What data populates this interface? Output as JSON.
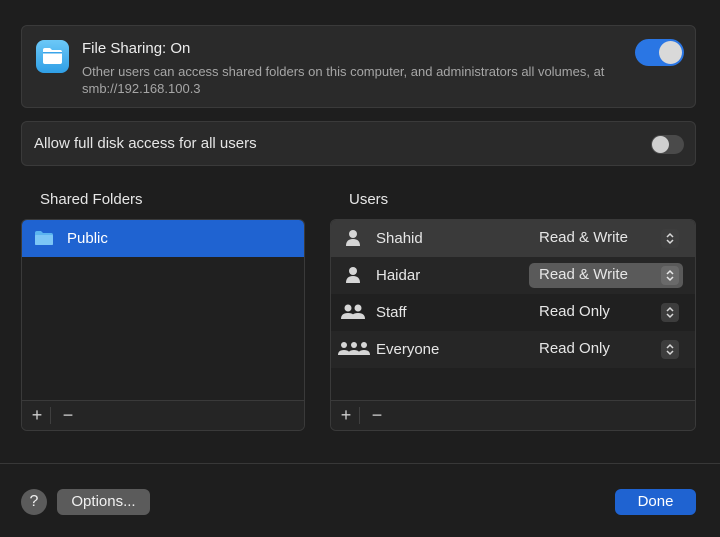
{
  "file_sharing": {
    "title": "File Sharing: On",
    "description": "Other users can access shared folders on this computer, and administrators all volumes, at smb://192.168.100.3",
    "enabled": true
  },
  "full_disk_access": {
    "label": "Allow full disk access for all users",
    "enabled": false
  },
  "shared_folders": {
    "title": "Shared Folders",
    "items": [
      {
        "name": "Public",
        "selected": true
      }
    ],
    "add_label": "+",
    "remove_label": "−"
  },
  "users": {
    "title": "Users",
    "items": [
      {
        "name": "Shahid",
        "permission": "Read & Write",
        "icon": "person-icon"
      },
      {
        "name": "Haidar",
        "permission": "Read & Write",
        "icon": "person-icon"
      },
      {
        "name": "Staff",
        "permission": "Read Only",
        "icon": "group-icon"
      },
      {
        "name": "Everyone",
        "permission": "Read Only",
        "icon": "everyone-icon"
      }
    ],
    "add_label": "+",
    "remove_label": "−"
  },
  "buttons": {
    "help": "?",
    "options": "Options...",
    "done": "Done"
  },
  "colors": {
    "accent": "#1f63d1",
    "toggle_on": "#2a76e4"
  }
}
